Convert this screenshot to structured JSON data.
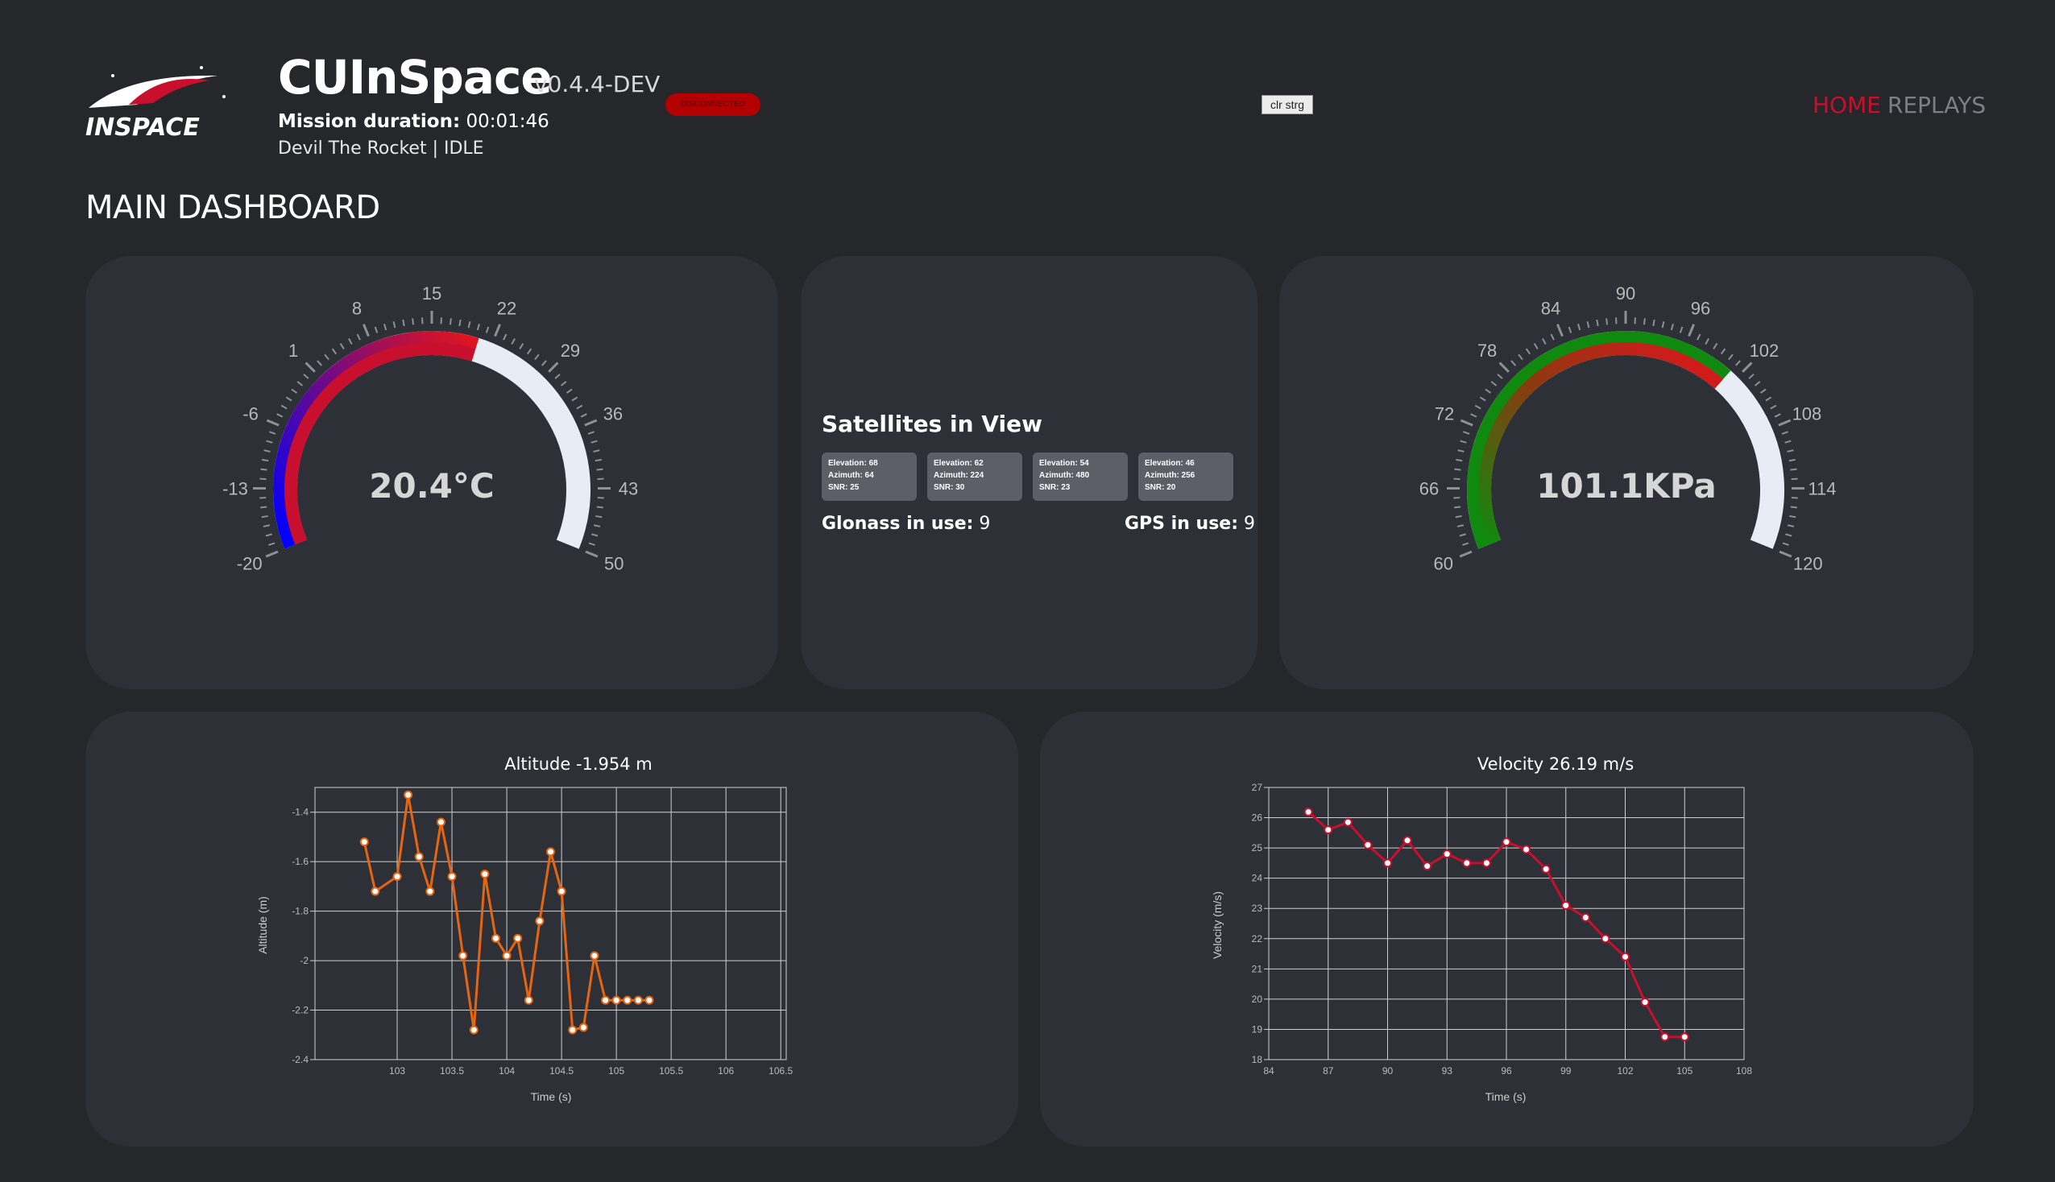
{
  "header": {
    "app_name": "CUInSpace",
    "version": "v0.4.4-DEV",
    "connection_status": "DISCONNECTED",
    "mission_duration_label": "Mission duration:",
    "mission_duration_value": "00:01:46",
    "rocket_status": "Devil The Rocket | IDLE",
    "clear_button": "clr strg",
    "logo_text": "INSPACE"
  },
  "nav": {
    "home": "HOME",
    "replays": "REPLAYS"
  },
  "page_title": "MAIN DASHBOARD",
  "temperature_gauge": {
    "value_text": "20.4°C",
    "min": -20,
    "max": 50,
    "value": 20.4,
    "tick_labels": [
      "-20",
      "-13",
      "-6",
      "1",
      "8",
      "15",
      "22",
      "29",
      "36",
      "43",
      "50"
    ],
    "colors": {
      "cold": "#0000ff",
      "warm": "#e0141e",
      "track": "#e8ecf5"
    }
  },
  "pressure_gauge": {
    "value_text": "101.1KPa",
    "min": 60,
    "max": 120,
    "value": 101.1,
    "tick_labels": [
      "60",
      "66",
      "72",
      "78",
      "84",
      "90",
      "96",
      "102",
      "108",
      "114",
      "120"
    ],
    "colors": {
      "outer": "#0f8a0f",
      "inner": "#e0141e",
      "track": "#e8ecf5"
    }
  },
  "satellites": {
    "title": "Satellites in View",
    "items": [
      {
        "elevation": "Elevation: 68",
        "azimuth": "Azimuth: 64",
        "snr": "SNR: 25"
      },
      {
        "elevation": "Elevation: 62",
        "azimuth": "Azimuth: 224",
        "snr": "SNR: 30"
      },
      {
        "elevation": "Elevation: 54",
        "azimuth": "Azimuth: 480",
        "snr": "SNR: 23"
      },
      {
        "elevation": "Elevation: 46",
        "azimuth": "Azimuth: 256",
        "snr": "SNR: 20"
      }
    ],
    "glonass_label": "Glonass in use:",
    "glonass_value": "9",
    "gps_label": "GPS in use:",
    "gps_value": "9"
  },
  "chart_data": [
    {
      "type": "line",
      "title": "Altitude -1.954 m",
      "xlabel": "Time (s)",
      "ylabel": "Altitude (m)",
      "color": "#e8650f",
      "xlim": [
        102.25,
        106.55
      ],
      "ylim": [
        -2.4,
        -1.3
      ],
      "x_ticks": [
        "103",
        "103.5",
        "104",
        "104.5",
        "105",
        "105.5",
        "106",
        "106.5"
      ],
      "y_ticks": [
        "-1.4",
        "-1.6",
        "-1.8",
        "-2",
        "-2.2",
        "-2.4"
      ],
      "x_tick_values": [
        103,
        103.5,
        104,
        104.5,
        105,
        105.5,
        106.0,
        106.5
      ],
      "y_tick_values": [
        -1.4,
        -1.6,
        -1.8,
        -2,
        -2.2,
        -2.4
      ],
      "x": [
        102.7,
        102.8,
        103.0,
        103.1,
        103.2,
        103.3,
        103.4,
        103.5,
        103.6,
        103.7,
        103.8,
        103.9,
        104.0,
        104.1,
        104.2,
        104.3,
        104.4,
        104.5,
        104.6,
        104.7,
        104.8,
        104.9,
        105.0,
        105.1,
        105.2,
        105.3
      ],
      "y": [
        -1.52,
        -1.72,
        -1.66,
        -1.33,
        -1.58,
        -1.72,
        -1.44,
        -1.66,
        -1.98,
        -2.28,
        -1.65,
        -1.91,
        -1.98,
        -1.91,
        -2.16,
        -1.84,
        -1.56,
        -1.72,
        -2.28,
        -2.27,
        -1.98,
        -2.16,
        -2.16,
        -2.16,
        -2.16,
        -2.16
      ]
    },
    {
      "type": "line",
      "title": "Velocity 26.19 m/s",
      "xlabel": "Time (s)",
      "ylabel": "Velocity (m/s)",
      "color": "#c8102e",
      "xlim": [
        84,
        108
      ],
      "ylim": [
        18,
        27
      ],
      "x_ticks": [
        "84",
        "87",
        "90",
        "93",
        "96",
        "99",
        "102",
        "105",
        "108"
      ],
      "y_ticks": [
        "18",
        "19",
        "20",
        "21",
        "22",
        "23",
        "24",
        "25",
        "26",
        "27"
      ],
      "x_tick_values": [
        84,
        87,
        90,
        93,
        96,
        99,
        102,
        105,
        108
      ],
      "y_tick_values": [
        18,
        19,
        20,
        21,
        22,
        23,
        24,
        25,
        26,
        27
      ],
      "x": [
        86.0,
        87.0,
        88.0,
        89.0,
        90.0,
        91.0,
        92.0,
        93.0,
        94.0,
        95.0,
        96.0,
        97.0,
        98.0,
        99.0,
        100.0,
        101.0,
        102.0,
        103.0,
        104.0,
        105.0
      ],
      "y": [
        26.19,
        25.6,
        25.85,
        25.1,
        24.5,
        25.25,
        24.4,
        24.8,
        24.5,
        24.5,
        25.2,
        24.95,
        24.3,
        23.1,
        22.7,
        22.0,
        21.4,
        19.9,
        18.75,
        18.75
      ]
    }
  ]
}
